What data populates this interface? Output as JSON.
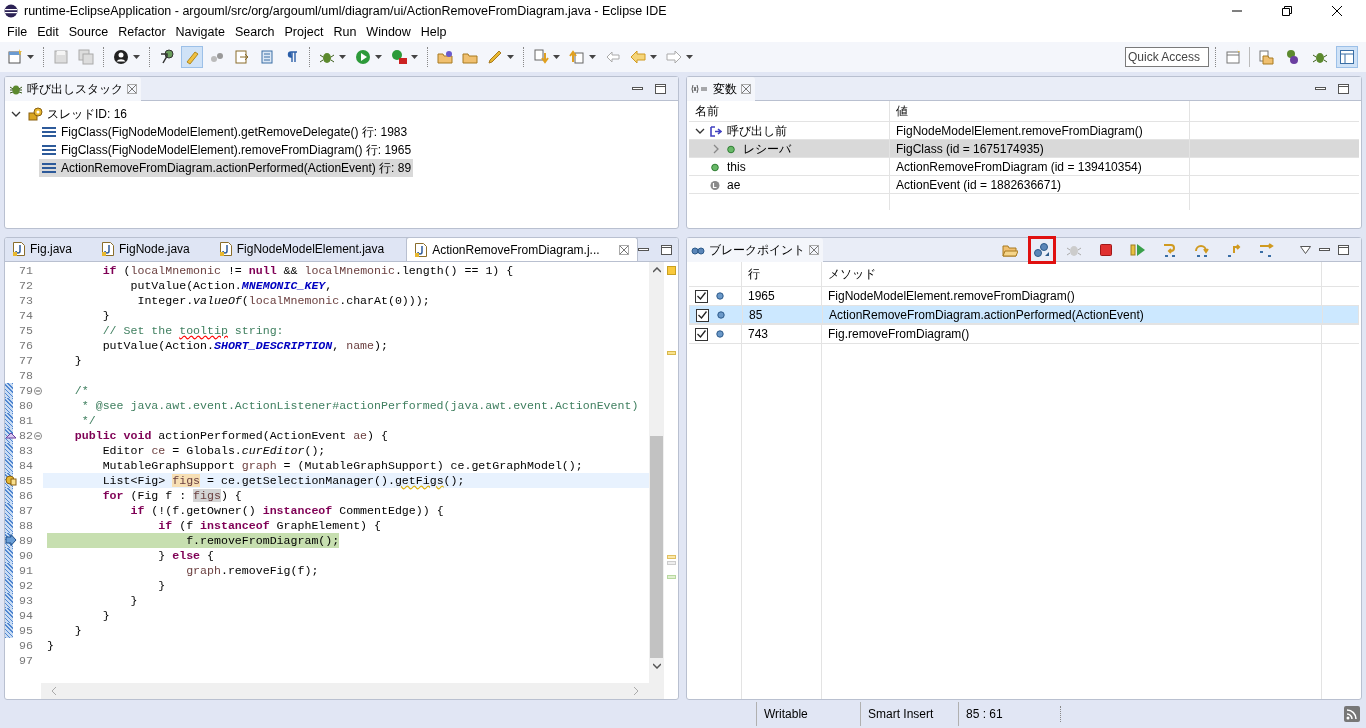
{
  "window": {
    "title": "runtime-EclipseApplication - argouml/src/org/argouml/uml/diagram/ui/ActionRemoveFromDiagram.java - Eclipse IDE"
  },
  "menu": [
    "File",
    "Edit",
    "Source",
    "Refactor",
    "Navigate",
    "Search",
    "Project",
    "Run",
    "Window",
    "Help"
  ],
  "quick_access": {
    "placeholder": "Quick Access"
  },
  "call_stack": {
    "title": "呼び出しスタック",
    "tree": [
      {
        "label": "スレッドID: 16",
        "expanded": true,
        "selected": false,
        "children": [
          {
            "label": "FigClass(FigNodeModelElement).getRemoveDelegate() 行: 1983",
            "selected": false
          },
          {
            "label": "FigClass(FigNodeModelElement).removeFromDiagram() 行: 1965",
            "selected": false
          },
          {
            "label": "ActionRemoveFromDiagram.actionPerformed(ActionEvent) 行: 89",
            "selected": true
          }
        ]
      }
    ]
  },
  "variables": {
    "title": "変数",
    "columns": [
      "名前",
      "値"
    ],
    "rows": [
      {
        "kind": "return",
        "name": "呼び出し前",
        "value": "FigNodeModelElement.removeFromDiagram()",
        "has_children": true,
        "expanded": true,
        "selected": false,
        "children": [
          {
            "kind": "field",
            "name": "レシーバ",
            "value": "FigClass (id = 1675174935)",
            "has_children": true,
            "expanded": false,
            "selected": true
          }
        ]
      },
      {
        "kind": "field",
        "name": "this",
        "value": "ActionRemoveFromDiagram (id = 139410354)",
        "has_children": false,
        "selected": false
      },
      {
        "kind": "local",
        "name": "ae",
        "value": "ActionEvent (id = 1882636671)",
        "has_children": false,
        "selected": false
      }
    ]
  },
  "editor": {
    "tabs": [
      {
        "label": "Fig.java",
        "selected": false
      },
      {
        "label": "FigNode.java",
        "selected": false
      },
      {
        "label": "FigNodeModelElement.java",
        "selected": false
      },
      {
        "label": "ActionRemoveFromDiagram.j...",
        "selected": true
      }
    ],
    "lines": [
      {
        "n": "71",
        "current": false,
        "executing": false,
        "foldable": false,
        "changed": false,
        "tokens": [
          {
            "text": "        if",
            "kind": "kw"
          },
          {
            "text": " (",
            "kind": "plain"
          },
          {
            "text": "localMnemonic",
            "kind": "var"
          },
          {
            "text": " != ",
            "kind": "plain"
          },
          {
            "text": "null",
            "kind": "kw"
          },
          {
            "text": " && ",
            "kind": "plain"
          },
          {
            "text": "localMnemonic",
            "kind": "var"
          },
          {
            "text": ".length() == 1) {",
            "kind": "plain"
          }
        ]
      },
      {
        "n": "72",
        "current": false,
        "executing": false,
        "foldable": false,
        "changed": false,
        "tokens": [
          {
            "text": "            putValue(Action.",
            "kind": "plain"
          },
          {
            "text": "MNEMONIC_KEY",
            "kind": "const"
          },
          {
            "text": ",",
            "kind": "plain"
          }
        ]
      },
      {
        "n": "73",
        "current": false,
        "executing": false,
        "foldable": false,
        "changed": false,
        "tokens": [
          {
            "text": "             Integer.",
            "kind": "plain"
          },
          {
            "text": "valueOf",
            "kind": "static"
          },
          {
            "text": "(",
            "kind": "plain"
          },
          {
            "text": "localMnemonic",
            "kind": "var"
          },
          {
            "text": ".charAt(0)));",
            "kind": "plain"
          }
        ]
      },
      {
        "n": "74",
        "current": false,
        "executing": false,
        "foldable": false,
        "changed": false,
        "tokens": [
          {
            "text": "        }",
            "kind": "plain"
          }
        ]
      },
      {
        "n": "75",
        "current": false,
        "executing": false,
        "foldable": false,
        "changed": false,
        "tokens": [
          {
            "text": "        // Set the ",
            "kind": "comment"
          },
          {
            "text": "tooltip",
            "kind": "misspelled"
          },
          {
            "text": " string:",
            "kind": "comment"
          }
        ]
      },
      {
        "n": "76",
        "current": false,
        "executing": false,
        "foldable": false,
        "changed": false,
        "tokens": [
          {
            "text": "        putValue(Action.",
            "kind": "plain"
          },
          {
            "text": "SHORT_DESCRIPTION",
            "kind": "const"
          },
          {
            "text": ", ",
            "kind": "plain"
          },
          {
            "text": "name",
            "kind": "var"
          },
          {
            "text": ");",
            "kind": "plain"
          }
        ]
      },
      {
        "n": "77",
        "current": false,
        "executing": false,
        "foldable": false,
        "changed": false,
        "tokens": [
          {
            "text": "    }",
            "kind": "plain"
          }
        ]
      },
      {
        "n": "78",
        "current": false,
        "executing": false,
        "foldable": false,
        "changed": false
      },
      {
        "n": "79",
        "current": false,
        "executing": false,
        "foldable": true,
        "changed": true,
        "tokens": [
          {
            "text": "    /*",
            "kind": "comment"
          }
        ]
      },
      {
        "n": "80",
        "current": false,
        "executing": false,
        "foldable": false,
        "changed": true,
        "tokens": [
          {
            "text": "     * @see java.awt.event.ActionListener#actionPerformed(java.awt.event.ActionEvent)",
            "kind": "comment"
          }
        ]
      },
      {
        "n": "81",
        "current": false,
        "executing": false,
        "foldable": false,
        "changed": true,
        "tokens": [
          {
            "text": "     */",
            "kind": "comment"
          }
        ]
      },
      {
        "n": "82",
        "current": false,
        "executing": false,
        "foldable": true,
        "changed": true,
        "marker": {
          "kind": "override"
        },
        "tokens": [
          {
            "text": "    public",
            "kind": "kw"
          },
          {
            "text": " void",
            "kind": "kw"
          },
          {
            "text": " actionPerformed(ActionEvent ",
            "kind": "plain"
          },
          {
            "text": "ae",
            "kind": "var"
          },
          {
            "text": ") {",
            "kind": "plain"
          }
        ]
      },
      {
        "n": "83",
        "current": false,
        "executing": false,
        "foldable": false,
        "changed": true,
        "tokens": [
          {
            "text": "        Editor ",
            "kind": "plain"
          },
          {
            "text": "ce",
            "kind": "var"
          },
          {
            "text": " = Globals.",
            "kind": "plain"
          },
          {
            "text": "curEditor",
            "kind": "static"
          },
          {
            "text": "();",
            "kind": "plain"
          }
        ]
      },
      {
        "n": "84",
        "current": false,
        "executing": false,
        "foldable": false,
        "changed": true,
        "tokens": [
          {
            "text": "        MutableGraphSupport ",
            "kind": "plain"
          },
          {
            "text": "graph",
            "kind": "var"
          },
          {
            "text": " = (MutableGraphSupport) ce.getGraphModel();",
            "kind": "plain"
          }
        ]
      },
      {
        "n": "85",
        "current": true,
        "executing": false,
        "foldable": false,
        "changed": true,
        "marker": {
          "kind": "warning"
        },
        "tokens": [
          {
            "text": "        List<Fig> ",
            "kind": "plain"
          },
          {
            "text": "figs",
            "kind": "occurrence"
          },
          {
            "text": " = ce.getSelectionManager().",
            "kind": "plain"
          },
          {
            "text": "getFigs",
            "kind": "deprecated"
          },
          {
            "text": "();",
            "kind": "plain"
          }
        ]
      },
      {
        "n": "86",
        "current": false,
        "executing": false,
        "foldable": false,
        "changed": true,
        "tokens": [
          {
            "text": "        for",
            "kind": "kw"
          },
          {
            "text": " (Fig f : ",
            "kind": "plain"
          },
          {
            "text": "figs",
            "kind": "occurrence-read"
          },
          {
            "text": ") {",
            "kind": "plain"
          }
        ]
      },
      {
        "n": "87",
        "current": false,
        "executing": false,
        "foldable": false,
        "changed": true,
        "tokens": [
          {
            "text": "            if",
            "kind": "kw"
          },
          {
            "text": " (!(f.getOwner() ",
            "kind": "plain"
          },
          {
            "text": "instanceof",
            "kind": "kw"
          },
          {
            "text": " CommentEdge)) {",
            "kind": "plain"
          }
        ]
      },
      {
        "n": "88",
        "current": false,
        "executing": false,
        "foldable": false,
        "changed": true,
        "tokens": [
          {
            "text": "                if",
            "kind": "kw"
          },
          {
            "text": " (f ",
            "kind": "plain"
          },
          {
            "text": "instanceof",
            "kind": "kw"
          },
          {
            "text": " GraphElement) {",
            "kind": "plain"
          }
        ]
      },
      {
        "n": "89",
        "current": false,
        "executing": true,
        "foldable": false,
        "changed": true,
        "marker": {
          "kind": "arrow"
        },
        "tokens": [
          {
            "text": "                    f.removeFromDiagram();",
            "kind": "plain"
          }
        ]
      },
      {
        "n": "90",
        "current": false,
        "executing": false,
        "foldable": false,
        "changed": true,
        "tokens": [
          {
            "text": "                } ",
            "kind": "plain"
          },
          {
            "text": "else",
            "kind": "kw"
          },
          {
            "text": " {",
            "kind": "plain"
          }
        ]
      },
      {
        "n": "91",
        "current": false,
        "executing": false,
        "foldable": false,
        "changed": true,
        "tokens": [
          {
            "text": "                    graph",
            "kind": "var"
          },
          {
            "text": ".removeFig(f);",
            "kind": "plain"
          }
        ]
      },
      {
        "n": "92",
        "current": false,
        "executing": false,
        "foldable": false,
        "changed": true,
        "tokens": [
          {
            "text": "                }",
            "kind": "plain"
          }
        ]
      },
      {
        "n": "93",
        "current": false,
        "executing": false,
        "foldable": false,
        "changed": true,
        "tokens": [
          {
            "text": "            }",
            "kind": "plain"
          }
        ]
      },
      {
        "n": "94",
        "current": false,
        "executing": false,
        "foldable": false,
        "changed": true,
        "tokens": [
          {
            "text": "        }",
            "kind": "plain"
          }
        ]
      },
      {
        "n": "95",
        "current": false,
        "executing": false,
        "foldable": false,
        "changed": true,
        "tokens": [
          {
            "text": "    }",
            "kind": "plain"
          }
        ]
      },
      {
        "n": "96",
        "current": false,
        "executing": false,
        "foldable": false,
        "changed": false,
        "tokens": [
          {
            "text": "}",
            "kind": "plain"
          }
        ]
      },
      {
        "n": "97",
        "current": false,
        "executing": false,
        "foldable": false,
        "changed": false
      }
    ]
  },
  "breakpoints": {
    "title": "ブレークポイント",
    "toolbar": [
      {
        "kind": "open",
        "highlighted": false
      },
      {
        "kind": "link",
        "highlighted": true
      },
      {
        "kind": "skip",
        "highlighted": false
      },
      {
        "kind": "terminate",
        "highlighted": false
      },
      {
        "kind": "resume",
        "highlighted": false
      },
      {
        "kind": "step-into",
        "highlighted": false
      },
      {
        "kind": "step-over",
        "highlighted": false
      },
      {
        "kind": "step-return",
        "highlighted": false
      },
      {
        "kind": "drop-frame",
        "highlighted": false
      }
    ],
    "columns": [
      "行",
      "メソッド"
    ],
    "rows": [
      {
        "checked": true,
        "line": "1965",
        "method": "FigNodeModelElement.removeFromDiagram()",
        "selected": false
      },
      {
        "checked": true,
        "line": "85",
        "method": "ActionRemoveFromDiagram.actionPerformed(ActionEvent)",
        "selected": true
      },
      {
        "checked": true,
        "line": "743",
        "method": "Fig.removeFromDiagram()",
        "selected": false
      }
    ]
  },
  "status_bar": [
    "Writable",
    "Smart Insert",
    "85 : 61"
  ]
}
